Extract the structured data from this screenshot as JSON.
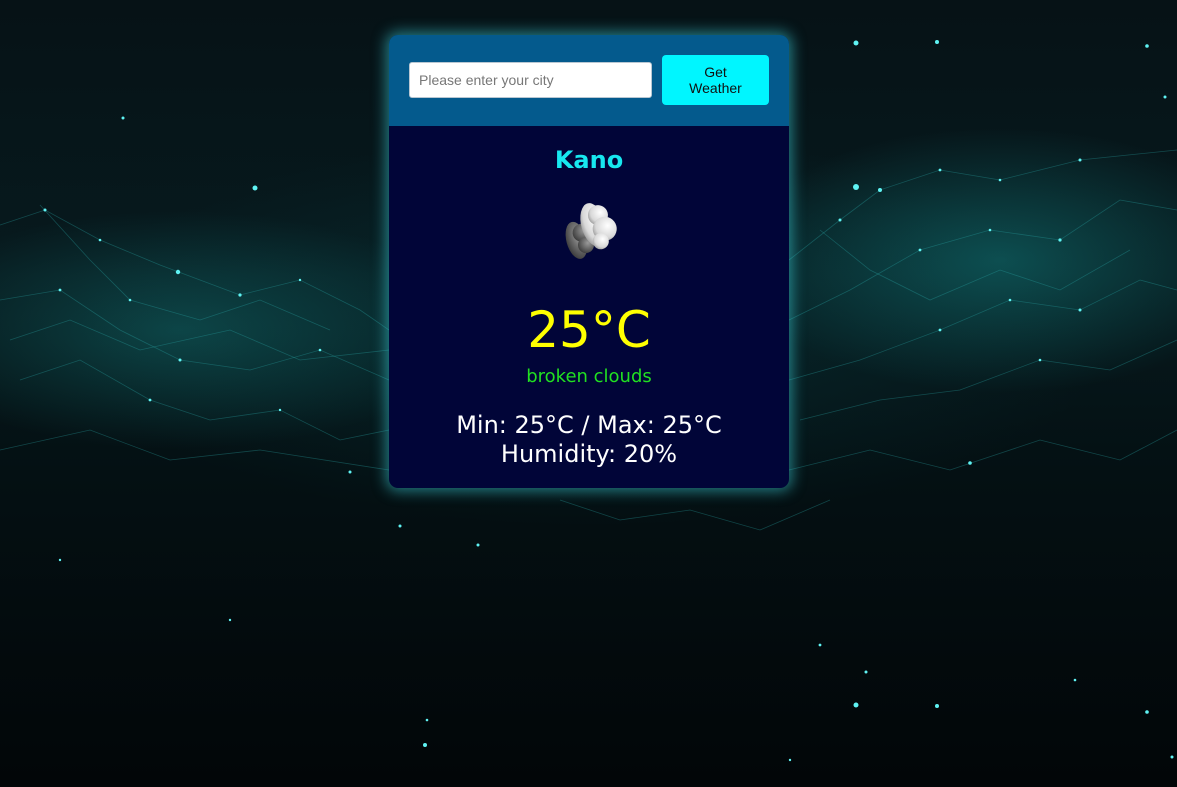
{
  "search": {
    "placeholder": "Please enter your city",
    "value": "",
    "button_label": "Get Weather"
  },
  "weather": {
    "city": "Kano",
    "icon": "broken-clouds-icon",
    "temperature": "25°C",
    "description": "broken clouds",
    "min_max": "Min: 25°C / Max: 25°C",
    "humidity": "Humidity: 20%"
  },
  "colors": {
    "header": "#045a8d",
    "card_body": "#010538",
    "button": "#00f6ff",
    "city": "#17e8ef",
    "temperature": "#ffff00",
    "description": "#21e021",
    "glow": "#3cd2dc"
  }
}
